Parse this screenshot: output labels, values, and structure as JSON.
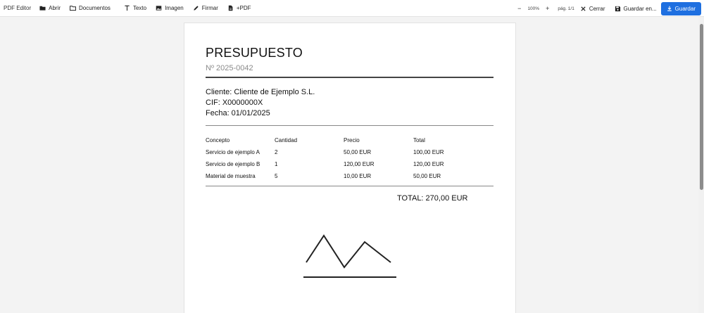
{
  "toolbar": {
    "brand": "PDF Editor",
    "open_label": "Abrir",
    "documents_label": "Documentos",
    "text_label": "Texto",
    "image_label": "Imagen",
    "sign_label": "Firmar",
    "add_pdf_label": "+PDF",
    "zoom_out": "−",
    "zoom_level": "100%",
    "zoom_in": "+",
    "page_info": "pág. 1/1",
    "close_label": "Cerrar",
    "save_as_label": "Guardar en...",
    "save_label": "Guardar",
    "accent_color": "#1e6fe0"
  },
  "document": {
    "title": "PRESUPUESTO",
    "number": "Nº 2025-0042",
    "client": "Cliente: Cliente de Ejemplo S.L.",
    "cif": "CIF: X0000000X",
    "date": "Fecha: 01/01/2025",
    "table": {
      "headers": [
        "Concepto",
        "Cantidad",
        "Precio",
        "Total"
      ],
      "rows": [
        [
          "Servicio de ejemplo A",
          "2",
          "50,00 EUR",
          "100,00 EUR"
        ],
        [
          "Servicio de ejemplo B",
          "1",
          "120,00 EUR",
          "120,00 EUR"
        ],
        [
          "Material de muestra",
          "5",
          "10,00 EUR",
          "50,00 EUR"
        ]
      ]
    },
    "total": "TOTAL: 270,00 EUR"
  }
}
